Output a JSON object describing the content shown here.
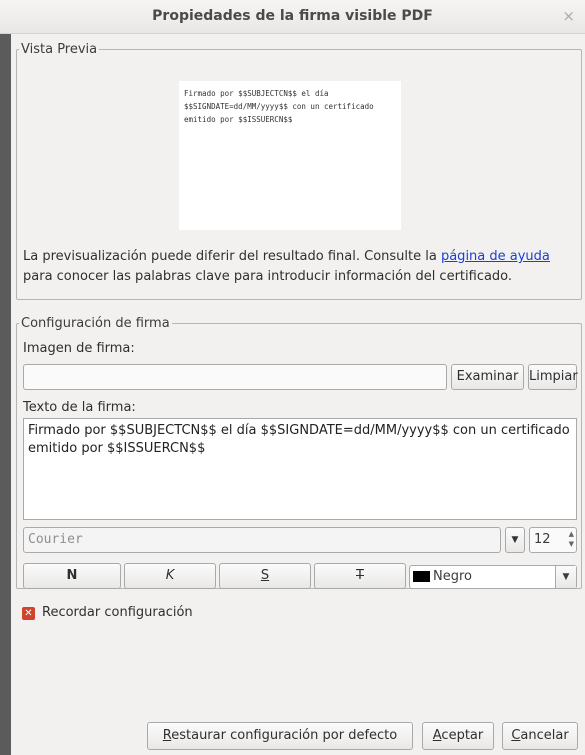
{
  "window": {
    "title": "Propiedades de la firma visible PDF",
    "close_glyph": "×"
  },
  "preview": {
    "legend": "Vista Previa",
    "sample_text": "Firmado por $$SUBJECTCN$$ el día $$SIGNDATE=dd/MM/yyyy$$ con un certificado emitido por $$ISSUERCN$$",
    "note_before": "La previsualización puede diferir del resultado final. Consulte la ",
    "note_link": "página de ayuda",
    "note_after": " para conocer las palabras clave para introducir información del certificado."
  },
  "config": {
    "legend": "Configuración de firma",
    "image_label": "Imagen de firma:",
    "image_value": "",
    "browse_button": "Examinar",
    "clear_button": "Limpiar",
    "text_label": "Texto de la firma:",
    "text_value": "Firmado por $$SUBJECTCN$$ el día $$SIGNDATE=dd/MM/yyyy$$ con un certificado emitido por $$ISSUERCN$$",
    "font_value": "Courier",
    "font_size": "12",
    "bold_button": "N",
    "italic_button": "K",
    "underline_button": "S",
    "strike_button": "T",
    "color_value": "Negro",
    "color_hex": "#000000"
  },
  "remember": {
    "label": "Recordar configuración",
    "checked": true
  },
  "footer": {
    "restore_mnemonic": "R",
    "restore_rest": "estaurar configuración por defecto",
    "accept_mnemonic": "A",
    "accept_rest": "ceptar",
    "cancel_mnemonic": "C",
    "cancel_rest": "ancelar"
  }
}
